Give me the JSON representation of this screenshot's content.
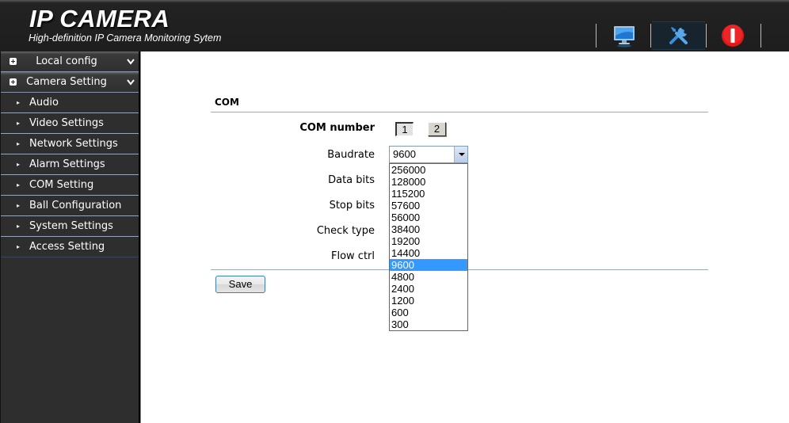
{
  "header": {
    "title": "IP CAMERA",
    "subtitle": "High-definition IP Camera Monitoring Sytem",
    "buttons": [
      {
        "icon": "monitor-icon",
        "label": "Live View"
      },
      {
        "icon": "wrench-screwdriver-icon",
        "label": "Settings",
        "active": true
      },
      {
        "icon": "power-icon",
        "label": "Logout"
      }
    ]
  },
  "sidebar": {
    "groups": [
      {
        "label": "Local config",
        "expanded": false
      },
      {
        "label": "Camera Setting",
        "expanded": true
      }
    ],
    "items": [
      {
        "label": "Audio"
      },
      {
        "label": "Video Settings"
      },
      {
        "label": "Network Settings"
      },
      {
        "label": "Alarm Settings"
      },
      {
        "label": "COM Setting"
      },
      {
        "label": "Ball Configuration"
      },
      {
        "label": "System Settings"
      },
      {
        "label": "Access Setting"
      }
    ]
  },
  "form": {
    "section_title": "COM",
    "com_number_label": "COM number",
    "com_options": [
      "1",
      "2"
    ],
    "com_selected": "1",
    "baudrate_label": "Baudrate",
    "baudrate_value": "9600",
    "baudrate_options": [
      "256000",
      "128000",
      "115200",
      "57600",
      "56000",
      "38400",
      "19200",
      "14400",
      "9600",
      "4800",
      "2400",
      "1200",
      "600",
      "300"
    ],
    "data_bits_label": "Data bits",
    "stop_bits_label": "Stop bits",
    "check_type_label": "Check type",
    "flow_ctrl_label": "Flow ctrl",
    "save_label": "Save"
  }
}
